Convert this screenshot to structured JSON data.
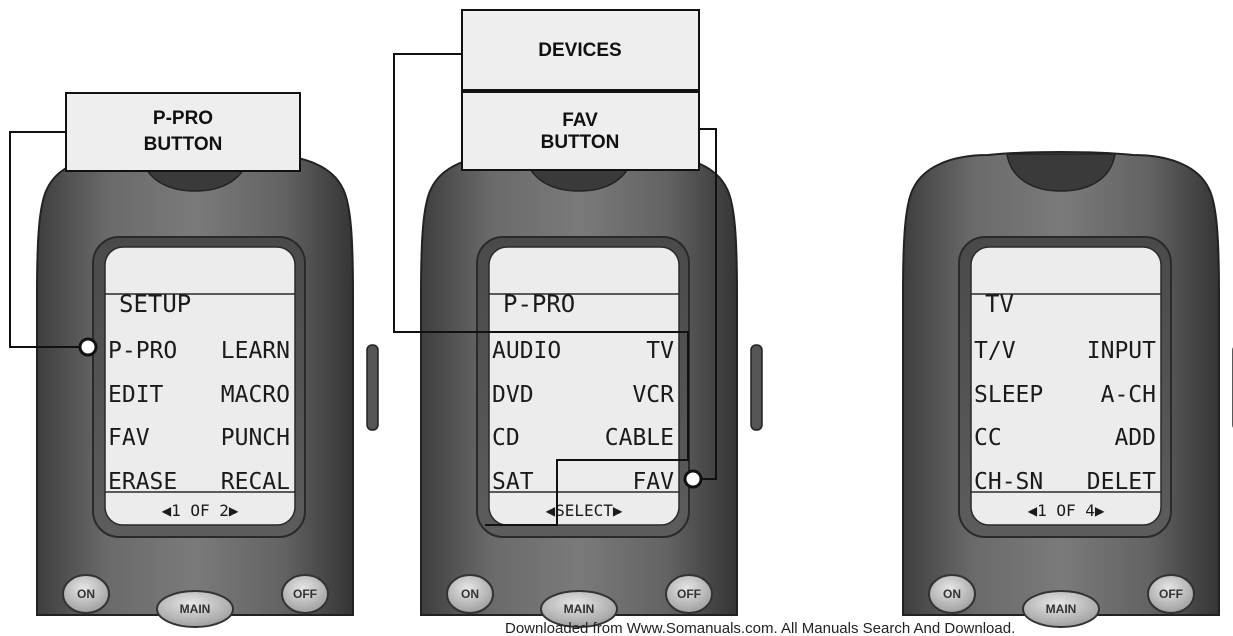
{
  "callouts": {
    "ppro_button": [
      "P-PRO",
      "BUTTON"
    ],
    "devices": "DEVICES",
    "fav_button": [
      "FAV",
      "BUTTON"
    ]
  },
  "remotes": [
    {
      "title": "SETUP",
      "rows": [
        [
          "P-PRO",
          "LEARN"
        ],
        [
          "EDIT",
          "MACRO"
        ],
        [
          "FAV",
          "PUNCH"
        ],
        [
          "ERASE",
          "RECAL"
        ]
      ],
      "footer": "◀1 OF 2▶"
    },
    {
      "title": "P-PRO",
      "rows": [
        [
          "AUDIO",
          "TV"
        ],
        [
          "DVD",
          "VCR"
        ],
        [
          "CD",
          "CABLE"
        ],
        [
          "SAT",
          "FAV"
        ]
      ],
      "footer": "◀SELECT▶"
    },
    {
      "title": "TV",
      "rows": [
        [
          "T/V",
          "INPUT"
        ],
        [
          "SLEEP",
          "A-CH"
        ],
        [
          "CC",
          "ADD"
        ],
        [
          "CH-SN",
          "DELET"
        ]
      ],
      "footer": "◀1 OF 4▶"
    }
  ],
  "hard_buttons": {
    "on": "ON",
    "main": "MAIN",
    "off": "OFF"
  },
  "footer_note": "Downloaded from Www.Somanuals.com. All Manuals Search And Download."
}
